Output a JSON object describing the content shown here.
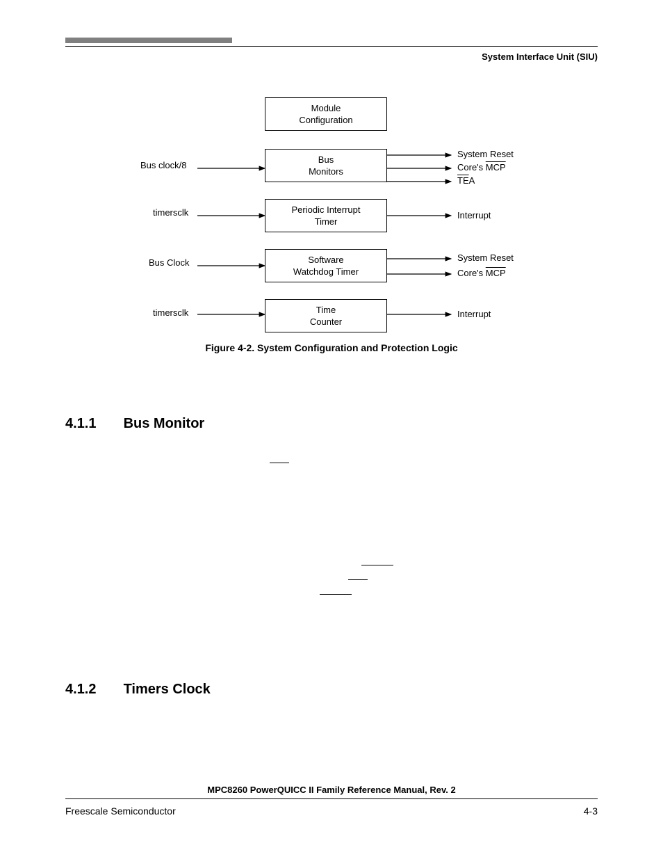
{
  "header": {
    "section": "System Interface Unit (SIU)"
  },
  "diagram": {
    "boxes": {
      "module_cfg": {
        "line1": "Module",
        "line2": "Configuration"
      },
      "bus_mon": {
        "line1": "Bus",
        "line2": "Monitors"
      },
      "pit": {
        "line1": "Periodic Interrupt",
        "line2": "Timer"
      },
      "swt": {
        "line1": "Software",
        "line2": "Watchdog Timer"
      },
      "tcnt": {
        "line1": "Time",
        "line2": "Counter"
      }
    },
    "inputs": {
      "bus_clock_8": "Bus clock/8",
      "timersclk1": "timersclk",
      "bus_clock": "Bus Clock",
      "timersclk2": "timersclk"
    },
    "outputs": {
      "sys_reset1": "System Reset",
      "cores_mcp1a": "Core's ",
      "cores_mcp1b": "MCP",
      "tea_a": "TE",
      "tea_b": "A",
      "interrupt1": "Interrupt",
      "sys_reset2": "System Reset",
      "cores_mcp2a": "Core's ",
      "cores_mcp2b": "MCP",
      "interrupt2": "Interrupt"
    },
    "caption": "Figure 4-2. System Configuration and Protection Logic"
  },
  "sections": {
    "s411": {
      "num": "4.1.1",
      "title": "Bus Monitor"
    },
    "s412": {
      "num": "4.1.2",
      "title": "Timers Clock"
    }
  },
  "footer": {
    "manual": "MPC8260 PowerQUICC II Family Reference Manual, Rev. 2",
    "vendor": "Freescale Semiconductor",
    "page": "4-3"
  }
}
